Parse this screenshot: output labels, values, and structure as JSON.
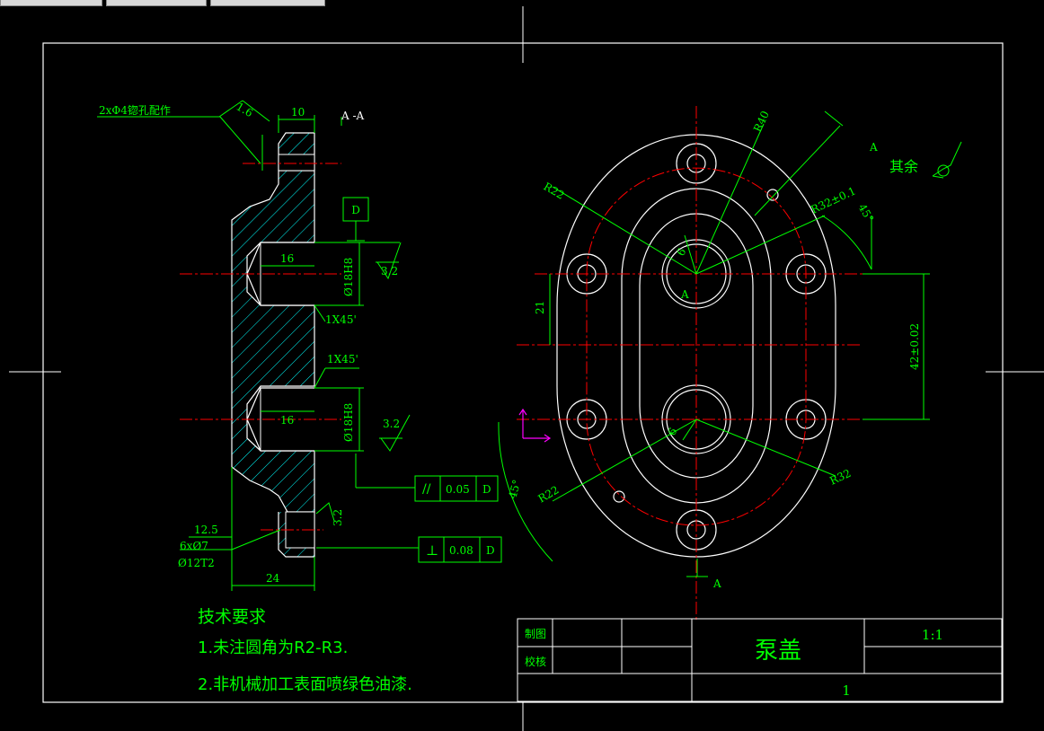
{
  "drawing": {
    "section_label": "A -A",
    "view_label_top": "A",
    "view_label_bottom": "A",
    "view_label_center": "A",
    "other_surfaces_label": "其余",
    "note_holes": "2xΦ4锪孔配作",
    "dim_10": "10",
    "dim_16_top": "16",
    "dim_16_bottom": "16",
    "dim_dia_top": "Ø18H8",
    "dim_dia_bottom": "Ø18H8",
    "chamfer_top": "1X45'",
    "chamfer_bottom": "1X45'",
    "rough_top": "3.2",
    "rough_bottom": "3.2",
    "rough_side": "3.2",
    "rough_corner": "1.6",
    "datum": "D",
    "tol_parallel_value": "0.05",
    "tol_parallel_datum": "D",
    "tol_perp_value": "0.08",
    "tol_perp_datum": "D",
    "dim_12_5": "12.5",
    "note_6x7": "6xØ7",
    "note_12t2": "Ø12T2",
    "dim_24": "24",
    "dim_r40": "R40",
    "dim_r22_top": "R22",
    "dim_r22_bottom": "R22",
    "dim_r32_tol": "R32±0.1",
    "dim_r32": "R32",
    "dim_45_top": "45°",
    "dim_45_bottom": "45°",
    "dim_21": "21",
    "dim_42": "42±0.02",
    "dim_6_top": "6",
    "dim_6_bottom": "6"
  },
  "tech_req": {
    "title": "技术要求",
    "line1": "1.未注圆角为R2-R3.",
    "line2": "2.非机械加工表面喷绿色油漆."
  },
  "title_block": {
    "drawn_label": "制图",
    "checked_label": "校核",
    "part_name": "泵盖",
    "scale": "1:1",
    "sheet": "1"
  },
  "colors": {
    "background": "#000000",
    "outline": "#ffffff",
    "dimension": "#00ff00",
    "centerline": "#ff0000",
    "hatch": "#00ffff",
    "ucs": "#ff00ff"
  }
}
